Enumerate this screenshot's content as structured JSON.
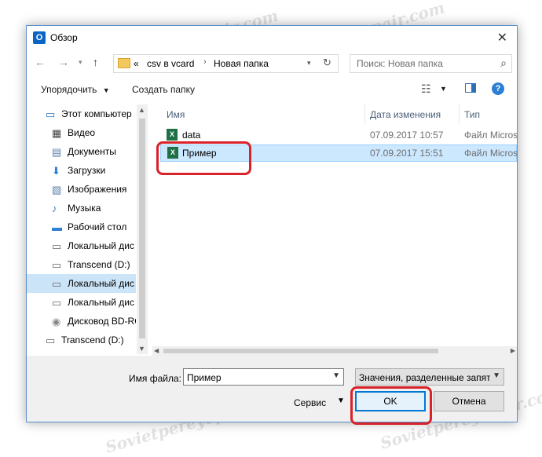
{
  "window": {
    "title": "Обзор",
    "app_icon": "O"
  },
  "nav": {
    "address": [
      "«",
      "csv в vcard",
      "Новая папка"
    ],
    "search_placeholder": "Поиск: Новая папка"
  },
  "toolbar": {
    "organize": "Упорядочить",
    "new_folder": "Создать папку"
  },
  "tree": [
    {
      "label": "Этот компьютер",
      "icon": "computer-icon",
      "level": 0,
      "selected": false
    },
    {
      "label": "Видео",
      "icon": "video-icon",
      "level": 1,
      "selected": false
    },
    {
      "label": "Документы",
      "icon": "documents-icon",
      "level": 1,
      "selected": false
    },
    {
      "label": "Загрузки",
      "icon": "download-icon",
      "level": 1,
      "selected": false
    },
    {
      "label": "Изображения",
      "icon": "images-icon",
      "level": 1,
      "selected": false
    },
    {
      "label": "Музыка",
      "icon": "music-icon",
      "level": 1,
      "selected": false
    },
    {
      "label": "Рабочий стол",
      "icon": "desktop-icon",
      "level": 1,
      "selected": false
    },
    {
      "label": "Локальный дис",
      "icon": "drive-icon",
      "level": 1,
      "selected": false
    },
    {
      "label": "Transcend (D:)",
      "icon": "drive-icon",
      "level": 1,
      "selected": false
    },
    {
      "label": "Локальный дис",
      "icon": "drive-icon",
      "level": 1,
      "selected": true
    },
    {
      "label": "Локальный дис",
      "icon": "drive-icon",
      "level": 1,
      "selected": false
    },
    {
      "label": "Дисковод BD-RO",
      "icon": "disc-icon",
      "level": 1,
      "selected": false
    },
    {
      "label": "Transcend (D:)",
      "icon": "drive-icon",
      "level": 0,
      "selected": false
    }
  ],
  "columns": {
    "name": "Имя",
    "date": "Дата изменения",
    "type": "Тип"
  },
  "files": [
    {
      "name": "data",
      "date": "07.09.2017 10:57",
      "type": "Файл Micros",
      "selected": false
    },
    {
      "name": "Пример",
      "date": "07.09.2017 15:51",
      "type": "Файл Micros",
      "selected": true
    }
  ],
  "bottom": {
    "filename_label": "Имя файла:",
    "filename_value": "Пример",
    "filetype": "Значения, разделенные запят",
    "service": "Сервис",
    "ok": "OK",
    "cancel": "Отмена"
  },
  "watermark": "Sovietpereyepair.com",
  "colors": {
    "highlight": "#d8232a",
    "selection": "#cce8ff",
    "accent": "#0078d7"
  }
}
